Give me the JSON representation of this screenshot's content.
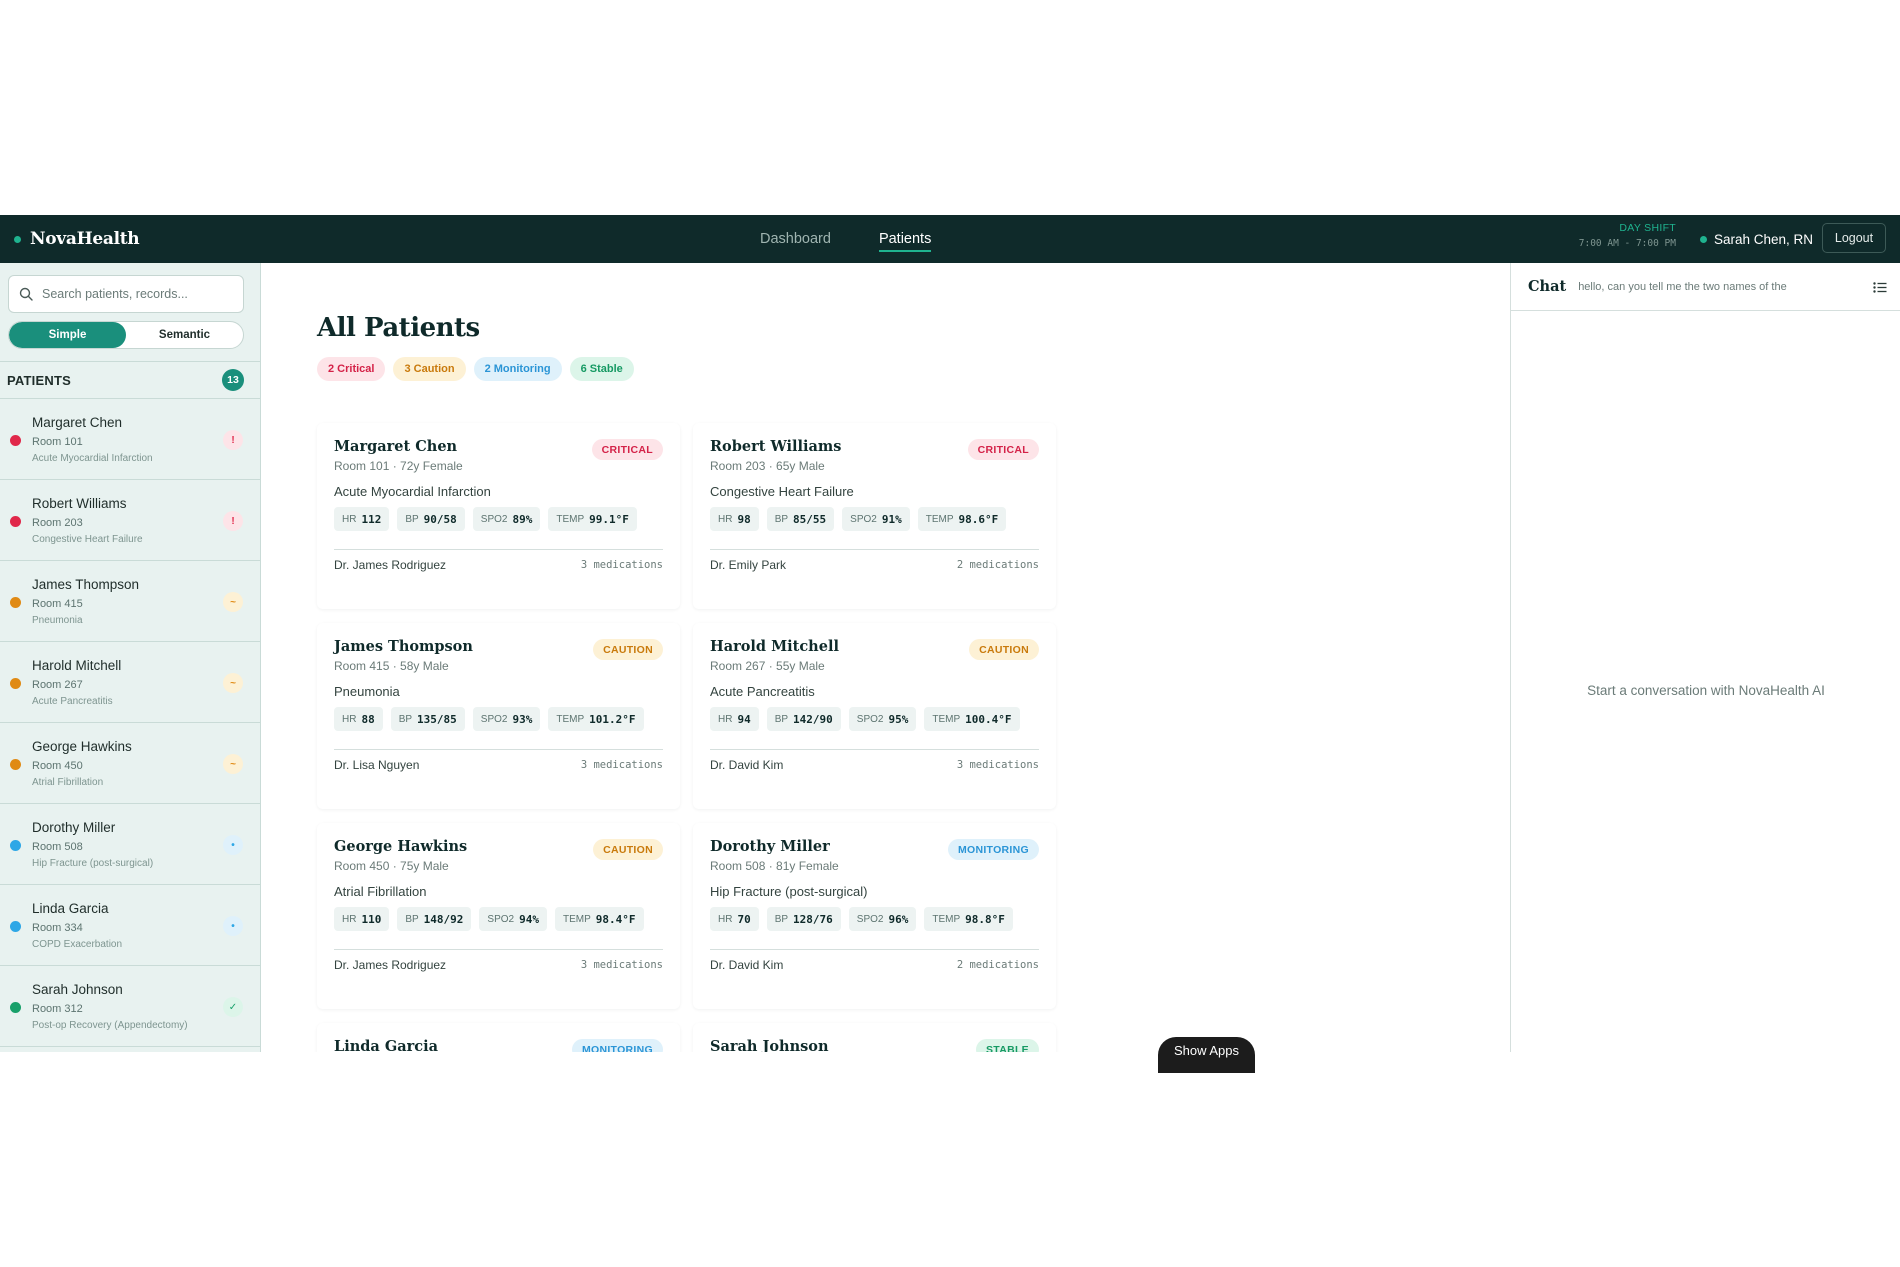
{
  "header": {
    "brand": "NovaHealth",
    "nav": [
      {
        "label": "Dashboard",
        "active": false
      },
      {
        "label": "Patients",
        "active": true
      }
    ],
    "shift_label": "DAY SHIFT",
    "shift_time": "7:00 AM - 7:00 PM",
    "user_name": "Sarah Chen, RN",
    "logout_label": "Logout"
  },
  "sidebar": {
    "search_placeholder": "Search patients, records...",
    "modes": [
      "Simple",
      "Semantic"
    ],
    "active_mode": "Simple",
    "section_label": "PATIENTS",
    "count": "13",
    "patients": [
      {
        "name": "Margaret Chen",
        "room": "Room 101",
        "dx": "Acute Myocardial Infarction",
        "status": "critical",
        "flag": "!"
      },
      {
        "name": "Robert Williams",
        "room": "Room 203",
        "dx": "Congestive Heart Failure",
        "status": "critical",
        "flag": "!"
      },
      {
        "name": "James Thompson",
        "room": "Room 415",
        "dx": "Pneumonia",
        "status": "caution",
        "flag": "~"
      },
      {
        "name": "Harold Mitchell",
        "room": "Room 267",
        "dx": "Acute Pancreatitis",
        "status": "caution",
        "flag": "~"
      },
      {
        "name": "George Hawkins",
        "room": "Room 450",
        "dx": "Atrial Fibrillation",
        "status": "caution",
        "flag": "~"
      },
      {
        "name": "Dorothy Miller",
        "room": "Room 508",
        "dx": "Hip Fracture (post-surgical)",
        "status": "monitoring",
        "flag": "•"
      },
      {
        "name": "Linda Garcia",
        "room": "Room 334",
        "dx": "COPD Exacerbation",
        "status": "monitoring",
        "flag": "•"
      },
      {
        "name": "Sarah Johnson",
        "room": "Room 312",
        "dx": "Post-op Recovery (Appendectomy)",
        "status": "stable",
        "flag": "✓"
      }
    ]
  },
  "main": {
    "title": "All Patients",
    "chips": [
      {
        "label": "2 Critical",
        "status": "critical"
      },
      {
        "label": "3 Caution",
        "status": "caution"
      },
      {
        "label": "2 Monitoring",
        "status": "monitoring"
      },
      {
        "label": "6 Stable",
        "status": "stable"
      }
    ],
    "vital_labels": {
      "hr": "HR",
      "bp": "BP",
      "spo2": "SPO2",
      "temp": "TEMP"
    },
    "cards": [
      {
        "name": "Margaret Chen",
        "meta": "Room 101 · 72y Female",
        "badge": "CRITICAL",
        "status": "critical",
        "dx": "Acute Myocardial Infarction",
        "hr": "112",
        "bp": "90/58",
        "spo2": "89%",
        "temp": "99.1°F",
        "doctor": "Dr. James Rodriguez",
        "meds": "3 medications"
      },
      {
        "name": "Robert Williams",
        "meta": "Room 203 · 65y Male",
        "badge": "CRITICAL",
        "status": "critical",
        "dx": "Congestive Heart Failure",
        "hr": "98",
        "bp": "85/55",
        "spo2": "91%",
        "temp": "98.6°F",
        "doctor": "Dr. Emily Park",
        "meds": "2 medications"
      },
      {
        "name": "James Thompson",
        "meta": "Room 415 · 58y Male",
        "badge": "CAUTION",
        "status": "caution",
        "dx": "Pneumonia",
        "hr": "88",
        "bp": "135/85",
        "spo2": "93%",
        "temp": "101.2°F",
        "doctor": "Dr. Lisa Nguyen",
        "meds": "3 medications"
      },
      {
        "name": "Harold Mitchell",
        "meta": "Room 267 · 55y Male",
        "badge": "CAUTION",
        "status": "caution",
        "dx": "Acute Pancreatitis",
        "hr": "94",
        "bp": "142/90",
        "spo2": "95%",
        "temp": "100.4°F",
        "doctor": "Dr. David Kim",
        "meds": "3 medications"
      },
      {
        "name": "George Hawkins",
        "meta": "Room 450 · 75y Male",
        "badge": "CAUTION",
        "status": "caution",
        "dx": "Atrial Fibrillation",
        "hr": "110",
        "bp": "148/92",
        "spo2": "94%",
        "temp": "98.4°F",
        "doctor": "Dr. James Rodriguez",
        "meds": "3 medications"
      },
      {
        "name": "Dorothy Miller",
        "meta": "Room 508 · 81y Female",
        "badge": "MONITORING",
        "status": "monitoring",
        "dx": "Hip Fracture (post-surgical)",
        "hr": "70",
        "bp": "128/76",
        "spo2": "96%",
        "temp": "98.8°F",
        "doctor": "Dr. David Kim",
        "meds": "2 medications"
      },
      {
        "name": "Linda Garcia",
        "meta": "",
        "badge": "MONITORING",
        "status": "monitoring",
        "dx": "",
        "hr": "",
        "bp": "",
        "spo2": "",
        "temp": "",
        "doctor": "",
        "meds": ""
      },
      {
        "name": "Sarah Johnson",
        "meta": "",
        "badge": "STABLE",
        "status": "stable",
        "dx": "",
        "hr": "",
        "bp": "",
        "spo2": "",
        "temp": "",
        "doctor": "",
        "meds": ""
      }
    ],
    "show_apps": "Show Apps"
  },
  "chat": {
    "title": "Chat",
    "input_value": "hello, can you tell me the two names of the",
    "empty_text": "Start a conversation with NovaHealth AI"
  },
  "colors": {
    "topbar": "#0f2a2a",
    "accent": "#1a8f7c",
    "critical": "#e0284a",
    "caution": "#e08a14",
    "monitoring": "#2ea7e6",
    "stable": "#18a06a"
  }
}
